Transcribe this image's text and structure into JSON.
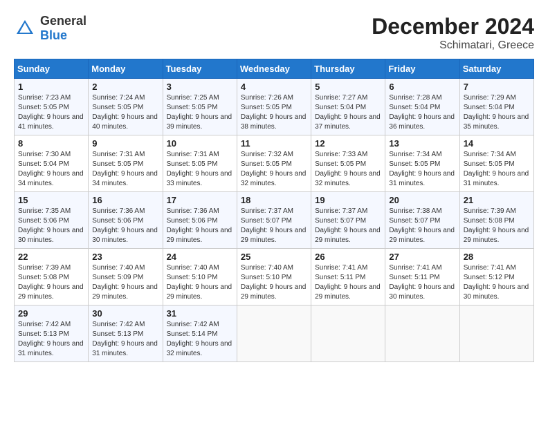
{
  "header": {
    "logo_general": "General",
    "logo_blue": "Blue",
    "month": "December 2024",
    "location": "Schimatari, Greece"
  },
  "weekdays": [
    "Sunday",
    "Monday",
    "Tuesday",
    "Wednesday",
    "Thursday",
    "Friday",
    "Saturday"
  ],
  "weeks": [
    [
      {
        "day": "1",
        "sunrise": "7:23 AM",
        "sunset": "5:05 PM",
        "daylight": "9 hours and 41 minutes."
      },
      {
        "day": "2",
        "sunrise": "7:24 AM",
        "sunset": "5:05 PM",
        "daylight": "9 hours and 40 minutes."
      },
      {
        "day": "3",
        "sunrise": "7:25 AM",
        "sunset": "5:05 PM",
        "daylight": "9 hours and 39 minutes."
      },
      {
        "day": "4",
        "sunrise": "7:26 AM",
        "sunset": "5:05 PM",
        "daylight": "9 hours and 38 minutes."
      },
      {
        "day": "5",
        "sunrise": "7:27 AM",
        "sunset": "5:04 PM",
        "daylight": "9 hours and 37 minutes."
      },
      {
        "day": "6",
        "sunrise": "7:28 AM",
        "sunset": "5:04 PM",
        "daylight": "9 hours and 36 minutes."
      },
      {
        "day": "7",
        "sunrise": "7:29 AM",
        "sunset": "5:04 PM",
        "daylight": "9 hours and 35 minutes."
      }
    ],
    [
      {
        "day": "8",
        "sunrise": "7:30 AM",
        "sunset": "5:04 PM",
        "daylight": "9 hours and 34 minutes."
      },
      {
        "day": "9",
        "sunrise": "7:31 AM",
        "sunset": "5:05 PM",
        "daylight": "9 hours and 34 minutes."
      },
      {
        "day": "10",
        "sunrise": "7:31 AM",
        "sunset": "5:05 PM",
        "daylight": "9 hours and 33 minutes."
      },
      {
        "day": "11",
        "sunrise": "7:32 AM",
        "sunset": "5:05 PM",
        "daylight": "9 hours and 32 minutes."
      },
      {
        "day": "12",
        "sunrise": "7:33 AM",
        "sunset": "5:05 PM",
        "daylight": "9 hours and 32 minutes."
      },
      {
        "day": "13",
        "sunrise": "7:34 AM",
        "sunset": "5:05 PM",
        "daylight": "9 hours and 31 minutes."
      },
      {
        "day": "14",
        "sunrise": "7:34 AM",
        "sunset": "5:05 PM",
        "daylight": "9 hours and 31 minutes."
      }
    ],
    [
      {
        "day": "15",
        "sunrise": "7:35 AM",
        "sunset": "5:06 PM",
        "daylight": "9 hours and 30 minutes."
      },
      {
        "day": "16",
        "sunrise": "7:36 AM",
        "sunset": "5:06 PM",
        "daylight": "9 hours and 30 minutes."
      },
      {
        "day": "17",
        "sunrise": "7:36 AM",
        "sunset": "5:06 PM",
        "daylight": "9 hours and 29 minutes."
      },
      {
        "day": "18",
        "sunrise": "7:37 AM",
        "sunset": "5:07 PM",
        "daylight": "9 hours and 29 minutes."
      },
      {
        "day": "19",
        "sunrise": "7:37 AM",
        "sunset": "5:07 PM",
        "daylight": "9 hours and 29 minutes."
      },
      {
        "day": "20",
        "sunrise": "7:38 AM",
        "sunset": "5:07 PM",
        "daylight": "9 hours and 29 minutes."
      },
      {
        "day": "21",
        "sunrise": "7:39 AM",
        "sunset": "5:08 PM",
        "daylight": "9 hours and 29 minutes."
      }
    ],
    [
      {
        "day": "22",
        "sunrise": "7:39 AM",
        "sunset": "5:08 PM",
        "daylight": "9 hours and 29 minutes."
      },
      {
        "day": "23",
        "sunrise": "7:40 AM",
        "sunset": "5:09 PM",
        "daylight": "9 hours and 29 minutes."
      },
      {
        "day": "24",
        "sunrise": "7:40 AM",
        "sunset": "5:10 PM",
        "daylight": "9 hours and 29 minutes."
      },
      {
        "day": "25",
        "sunrise": "7:40 AM",
        "sunset": "5:10 PM",
        "daylight": "9 hours and 29 minutes."
      },
      {
        "day": "26",
        "sunrise": "7:41 AM",
        "sunset": "5:11 PM",
        "daylight": "9 hours and 29 minutes."
      },
      {
        "day": "27",
        "sunrise": "7:41 AM",
        "sunset": "5:11 PM",
        "daylight": "9 hours and 30 minutes."
      },
      {
        "day": "28",
        "sunrise": "7:41 AM",
        "sunset": "5:12 PM",
        "daylight": "9 hours and 30 minutes."
      }
    ],
    [
      {
        "day": "29",
        "sunrise": "7:42 AM",
        "sunset": "5:13 PM",
        "daylight": "9 hours and 31 minutes."
      },
      {
        "day": "30",
        "sunrise": "7:42 AM",
        "sunset": "5:13 PM",
        "daylight": "9 hours and 31 minutes."
      },
      {
        "day": "31",
        "sunrise": "7:42 AM",
        "sunset": "5:14 PM",
        "daylight": "9 hours and 32 minutes."
      },
      null,
      null,
      null,
      null
    ]
  ]
}
